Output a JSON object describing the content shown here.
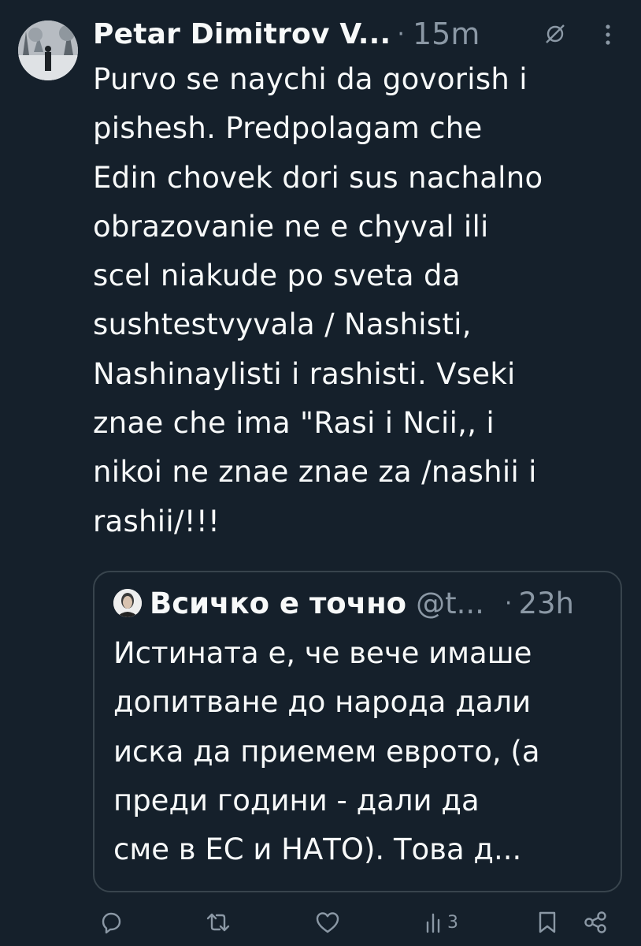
{
  "tweet": {
    "author_name": "Petar Dimitrov V...",
    "separator": "·",
    "time": "15m",
    "text": "Purvo se naychi da govorish i\npishesh. Predpolagam che\nEdin chovek dori sus nachalno\nobrazovanie ne e chyval ili\nscel niakude po sveta da\nsushtestvyvala / Nashisti,\nNashinaylisti i rashisti. Vseki\nznae che ima \"Rasi i Ncii,, i\nnikoi ne znae znae za /nashii i\nrashii/!!!",
    "icons": {
      "grok": "grok-icon",
      "more": "more-icon"
    }
  },
  "quote": {
    "author_name": "Всичко е точно",
    "handle": "@t...",
    "separator": "·",
    "time": "23h",
    "text": "Истината е, че вече имаше\nдопитване до народа дали\nиска да приемем еврото, (а\nпреди години - дали да\nсме в ЕС и НАТО). Това д..."
  },
  "actions": {
    "views_count": "3",
    "icons": [
      "reply-icon",
      "retweet-icon",
      "like-icon",
      "views-icon",
      "bookmark-icon",
      "share-icon"
    ]
  },
  "colors": {
    "background": "#15202b",
    "text": "#f7f9f9",
    "secondary": "#8b98a5",
    "border": "#38444d"
  }
}
